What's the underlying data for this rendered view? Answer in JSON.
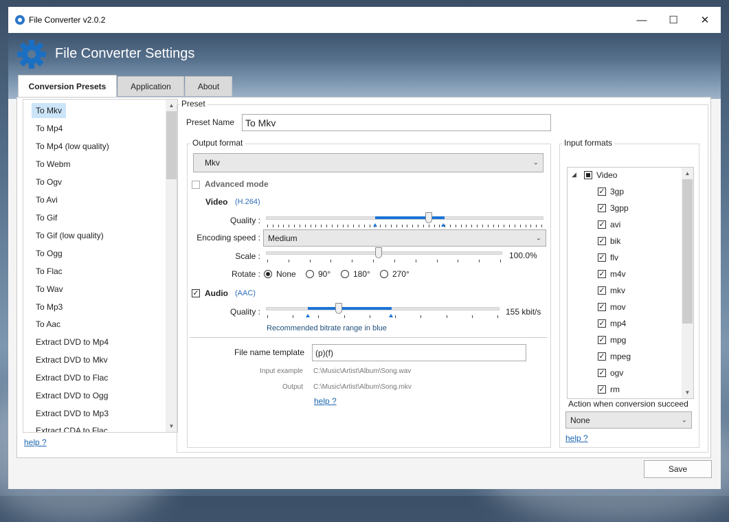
{
  "window": {
    "title": "File Converter v2.0.2"
  },
  "header": {
    "title": "File Converter Settings"
  },
  "tabs": [
    {
      "label": "Conversion Presets",
      "active": true
    },
    {
      "label": "Application",
      "active": false
    },
    {
      "label": "About",
      "active": false
    }
  ],
  "presets": {
    "items": [
      "To Mkv",
      "To Mp4",
      "To Mp4 (low quality)",
      "To Webm",
      "To Ogv",
      "To Avi",
      "To Gif",
      "To Gif (low quality)",
      "To Ogg",
      "To Flac",
      "To Wav",
      "To Mp3",
      "To Aac",
      "Extract DVD to Mp4",
      "Extract DVD to Mkv",
      "Extract DVD to Flac",
      "Extract DVD to Ogg",
      "Extract DVD to Mp3",
      "Extract CDA to Flac"
    ],
    "selected": "To Mkv",
    "help": "help ?"
  },
  "preset": {
    "group_label": "Preset",
    "name_label": "Preset Name",
    "name_value": "To Mkv"
  },
  "output": {
    "group_label": "Output format",
    "format": "Mkv",
    "advanced_label": "Advanced mode",
    "advanced_checked": false,
    "video": {
      "label": "Video",
      "codec": "(H.264)",
      "enabled": true,
      "quality_label": "Quality :",
      "encoding_label": "Encoding speed :",
      "encoding_value": "Medium",
      "scale_label": "Scale :",
      "scale_value": "100.0%",
      "rotate_label": "Rotate :",
      "rotate_options": [
        "None",
        "90°",
        "180°",
        "270°"
      ],
      "rotate_selected": "None"
    },
    "audio": {
      "label": "Audio",
      "codec": "(AAC)",
      "enabled": true,
      "quality_label": "Quality :",
      "bitrate": "155 kbit/s",
      "hint": "Recommended bitrate range in blue"
    },
    "filename": {
      "label": "File name template",
      "value": "(p)(f)",
      "input_example_label": "Input example",
      "input_example": "C:\\Music\\Artist\\Album\\Song.wav",
      "output_label": "Output",
      "output_example": "C:\\Music\\Artist\\Album\\Song.mkv",
      "help": "help ?"
    }
  },
  "input_formats": {
    "group_label": "Input formats",
    "category": "Video",
    "items": [
      "3gp",
      "3gpp",
      "avi",
      "bik",
      "flv",
      "m4v",
      "mkv",
      "mov",
      "mp4",
      "mpg",
      "mpeg",
      "ogv",
      "rm"
    ],
    "action_label": "Action when conversion succeed",
    "action_value": "None",
    "help": "help ?"
  },
  "footer": {
    "save_label": "Save"
  }
}
